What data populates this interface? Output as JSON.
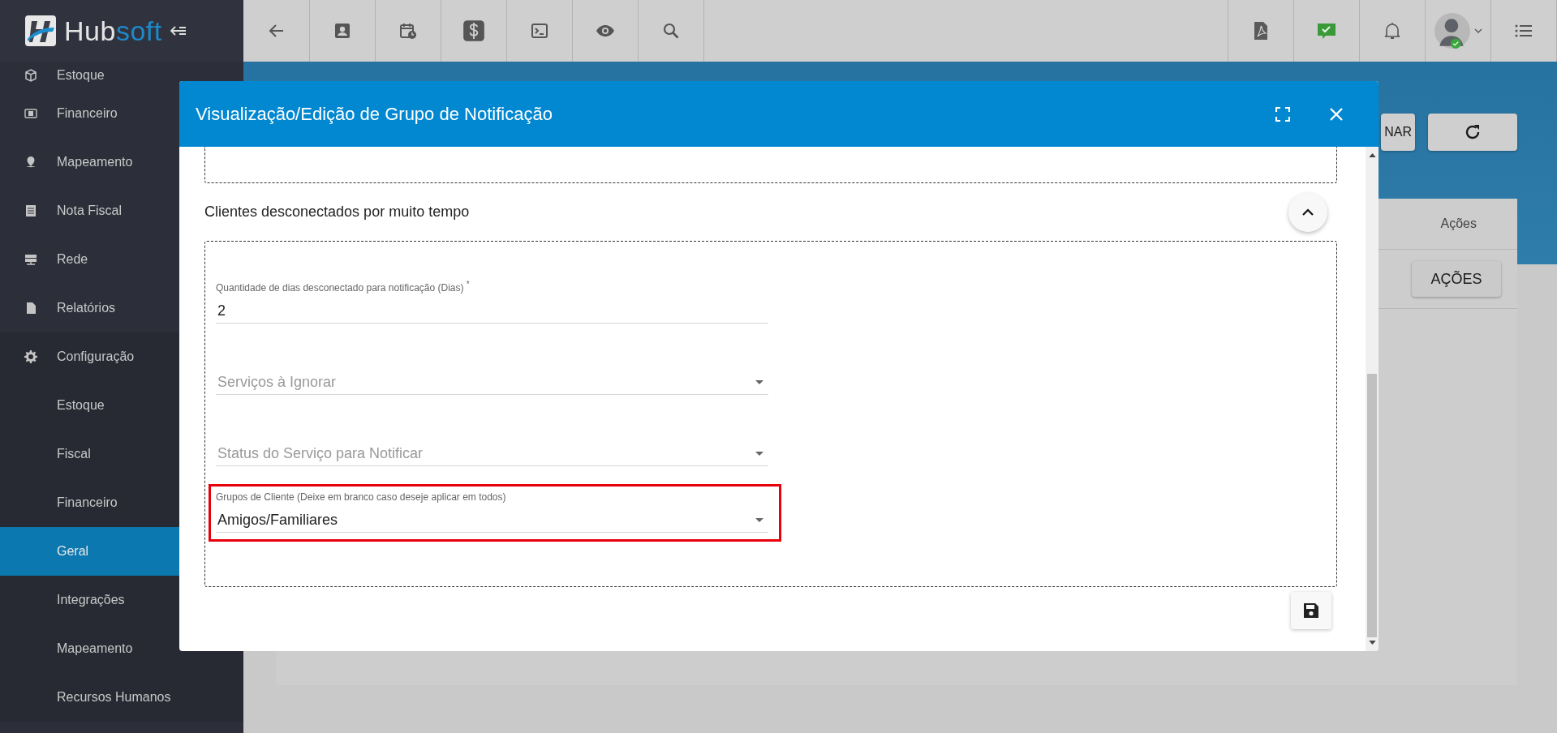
{
  "brand": {
    "name_start": "Hub",
    "name_end": "soft"
  },
  "sidebar": {
    "items": [
      {
        "label": "Estoque",
        "selected": false
      },
      {
        "label": "Financeiro",
        "selected": false
      },
      {
        "label": "Mapeamento",
        "selected": false
      },
      {
        "label": "Nota Fiscal",
        "selected": false
      },
      {
        "label": "Rede",
        "selected": false
      },
      {
        "label": "Relatórios",
        "selected": false
      },
      {
        "label": "Configuração",
        "selected": false,
        "children": [
          {
            "label": "Estoque",
            "selected": false
          },
          {
            "label": "Fiscal",
            "selected": false
          },
          {
            "label": "Financeiro",
            "selected": false
          },
          {
            "label": "Geral",
            "selected": true
          },
          {
            "label": "Integrações",
            "selected": false
          },
          {
            "label": "Mapeamento",
            "selected": false
          },
          {
            "label": "Recursos Humanos",
            "selected": false
          }
        ]
      }
    ]
  },
  "page": {
    "toolbar_buttons": [
      {
        "kind": "text",
        "label": "NAR"
      },
      {
        "kind": "refresh"
      }
    ],
    "table": {
      "columns": [
        "Ações"
      ],
      "rows": [
        {
          "action_button": "AÇÕES"
        }
      ]
    }
  },
  "modal": {
    "title": "Visualização/Edição de Grupo de Notificação",
    "section": {
      "title": "Clientes desconectados por muito tempo",
      "expanded": true,
      "fields": [
        {
          "kind": "text",
          "label": "Quantidade de dias desconectado para notificação (Dias) $^{*}$",
          "value": "2",
          "highlighted": false
        },
        {
          "kind": "select",
          "placeholder": "Serviços à Ignorar",
          "highlighted": false
        },
        {
          "kind": "select",
          "placeholder": "Status do Serviço para Notificar",
          "highlighted": false
        },
        {
          "kind": "select",
          "label": "Grupos de Cliente (Deixe em branco caso deseje aplicar em todos)",
          "value": "Amigos/Familiares",
          "highlighted": true
        }
      ]
    }
  }
}
